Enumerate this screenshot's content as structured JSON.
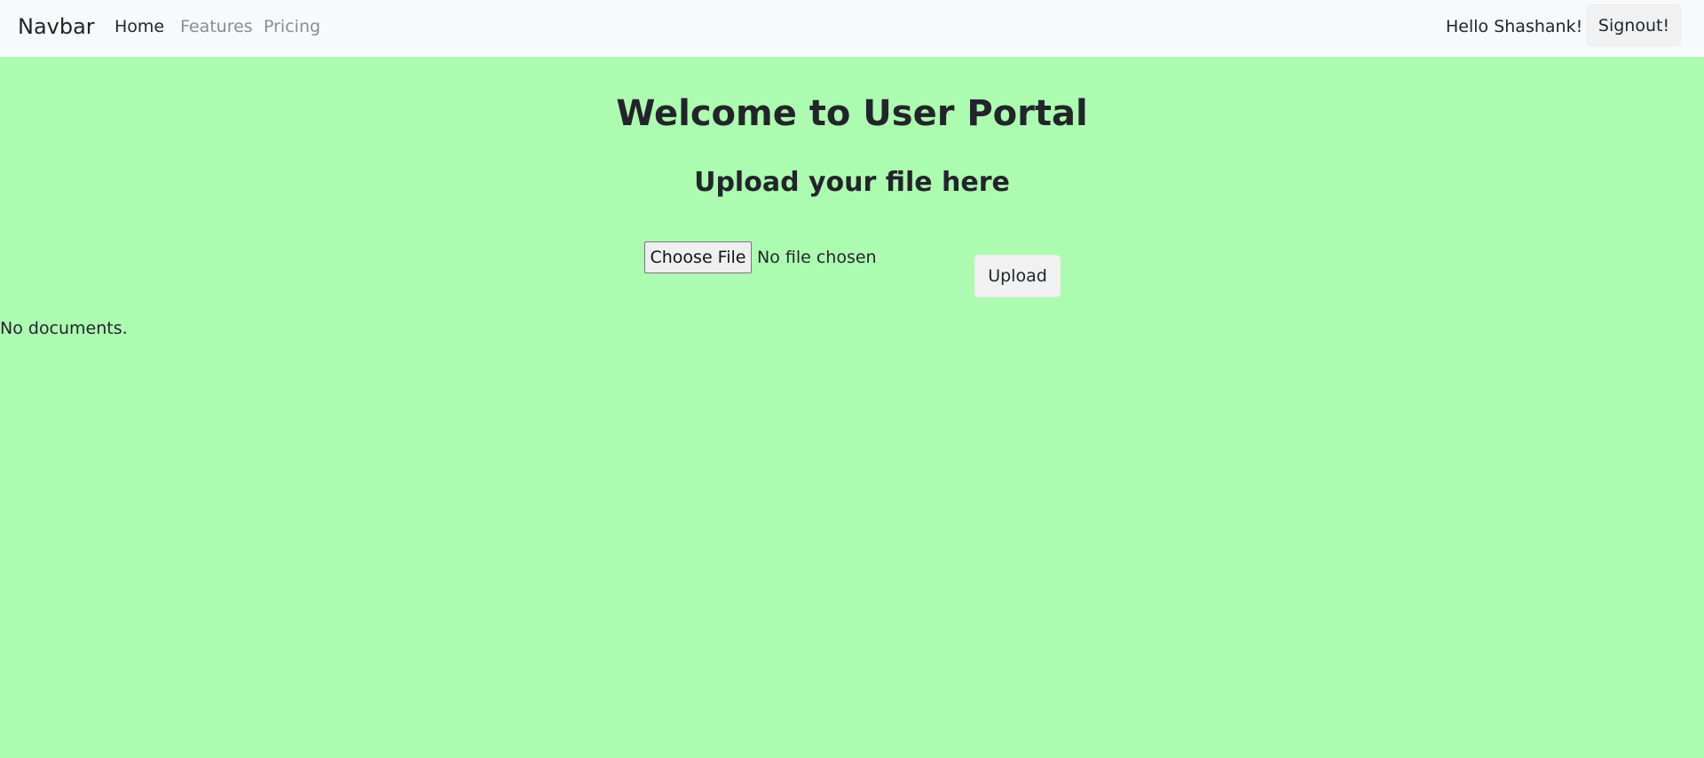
{
  "navbar": {
    "brand": "Navbar",
    "links": [
      "Home",
      "Features",
      "Pricing"
    ],
    "greeting": "Hello Shashank!",
    "signout_label": "Signout!"
  },
  "main": {
    "title": "Welcome to User Portal",
    "subtitle": "Upload your file here",
    "choose_file_label": "Choose File",
    "file_status": "No file chosen",
    "upload_label": "Upload",
    "documents_message": "No documents."
  },
  "colors": {
    "page_background": "#adfbb1",
    "navbar_background": "#f8f9fa",
    "active_link": "#212529",
    "inactive_link": "#868e96"
  }
}
